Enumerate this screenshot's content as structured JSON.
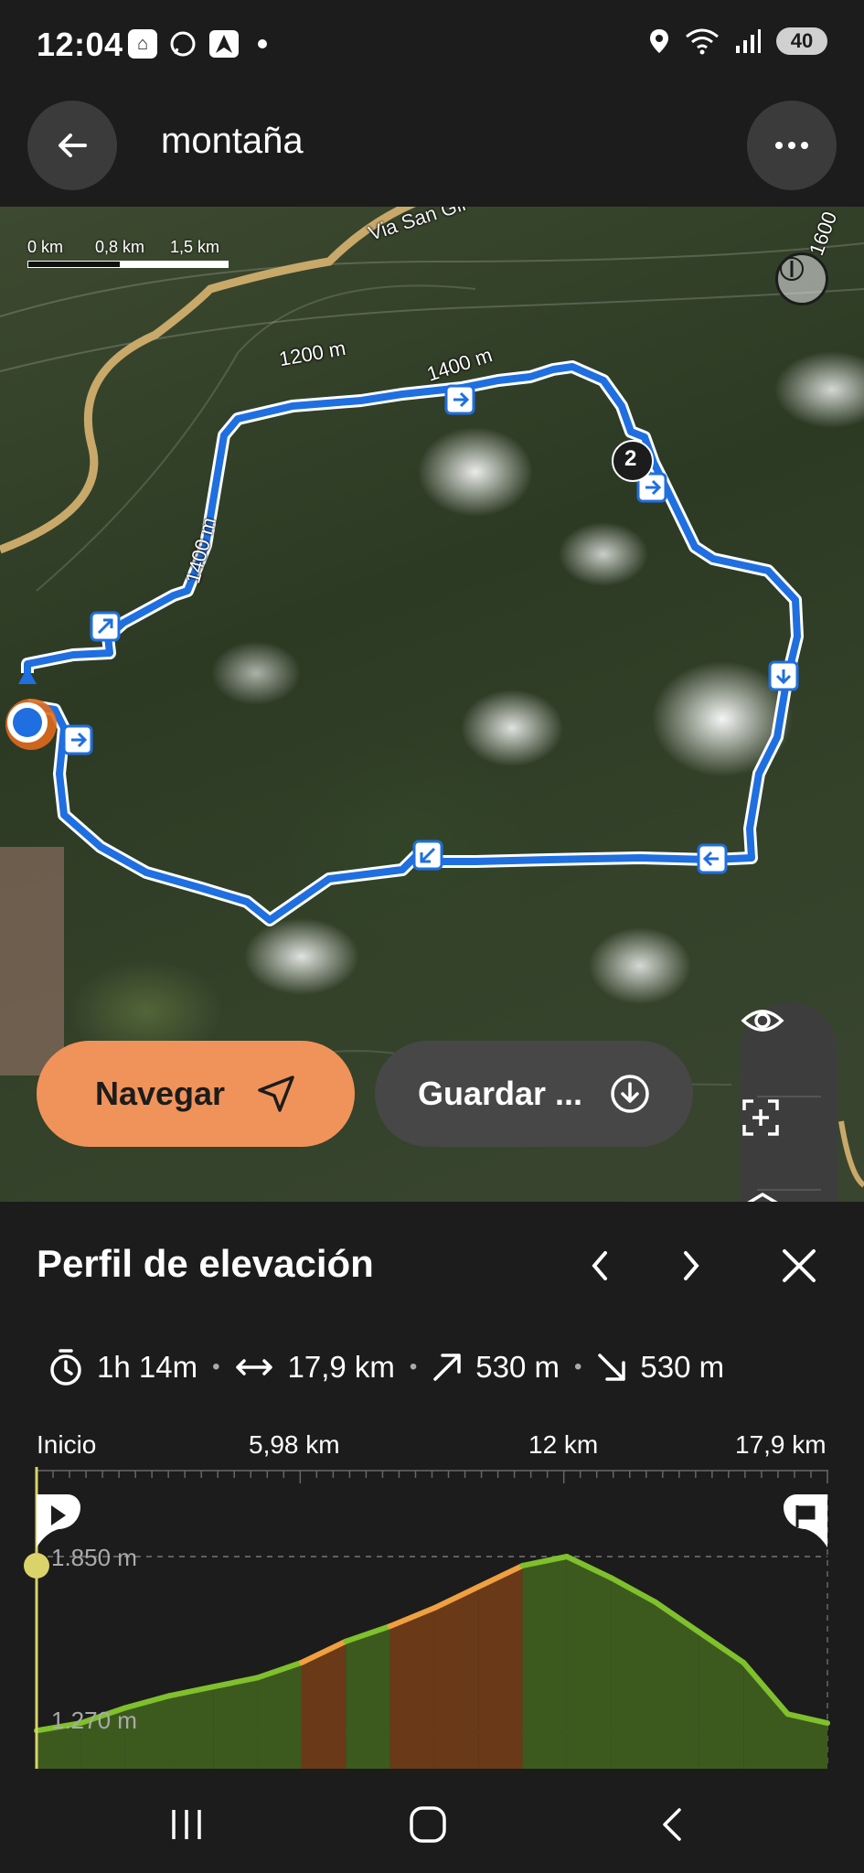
{
  "status_bar": {
    "time": "12:04",
    "battery": "40",
    "icons_left": [
      "app-icon",
      "whatsapp-icon",
      "navigation-app-icon",
      "notification-dot"
    ],
    "icons_right": [
      "location-icon",
      "wifi-icon",
      "signal-icon",
      "battery-icon"
    ]
  },
  "app_bar": {
    "title": "montaña"
  },
  "map": {
    "scale_labels": [
      "0 km",
      "0,8 km",
      "1,5 km"
    ],
    "labels": {
      "road": "Via San Gil - Socorro",
      "contour_1200": "1200 m",
      "contour_1400_top": "1400 m",
      "contour_1400_left": "1400 m",
      "contour_1600": "1600",
      "waypoint": "2"
    },
    "route_color": "#1f6fe0",
    "buttons": {
      "navigate": "Navegar",
      "save": "Guardar ..."
    },
    "side_tools": [
      "eye-icon",
      "frame-add-icon",
      "layers-icon",
      "locate-icon"
    ]
  },
  "elevation": {
    "title": "Perfil de elevación",
    "stats": {
      "duration": "1h 14m",
      "distance": "17,9 km",
      "ascent": "530 m",
      "descent": "530 m"
    },
    "distance_axis": [
      "Inicio",
      "5,98 km",
      "12 km",
      "17,9 km"
    ],
    "elev_max_label": "1.850 m",
    "elev_min_label": "1.270 m"
  },
  "chart_data": {
    "type": "area",
    "x": [
      0,
      1,
      2,
      3,
      4,
      5,
      6,
      7,
      8,
      9,
      10,
      11,
      12,
      13,
      14,
      15,
      16,
      17,
      17.9
    ],
    "y": [
      1275,
      1300,
      1350,
      1390,
      1420,
      1450,
      1500,
      1570,
      1620,
      1680,
      1750,
      1820,
      1850,
      1780,
      1700,
      1600,
      1500,
      1330,
      1300
    ],
    "xlabel": "",
    "ylabel": "",
    "xlim": [
      0,
      17.9
    ],
    "ylim": [
      1270,
      1850
    ],
    "x_tick_labels": [
      "Inicio",
      "5,98 km",
      "12 km",
      "17,9 km"
    ],
    "y_tick_labels": [
      "1.850 m",
      "1.270 m"
    ],
    "colors": {
      "line_gentle": "#7fc02c",
      "line_steep": "#f0a040",
      "fill": "#3d5a1e",
      "fill_steep": "#6a3a18"
    }
  },
  "nav_bar": {
    "items": [
      "recents-icon",
      "home-icon",
      "back-icon"
    ]
  }
}
